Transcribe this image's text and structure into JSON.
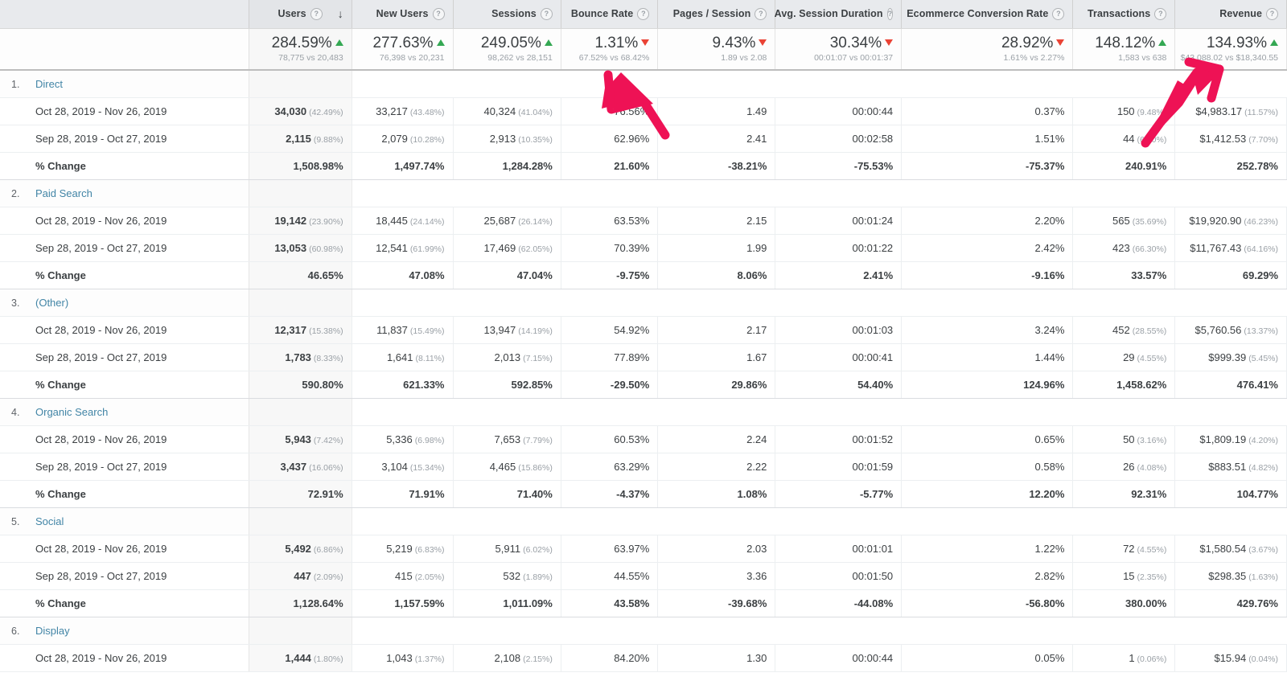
{
  "table": {
    "dimension_header": "",
    "columns": [
      {
        "key": "users",
        "label": "Users",
        "help": "?",
        "sorted": true,
        "sort_dir": "desc"
      },
      {
        "key": "new_users",
        "label": "New Users",
        "help": "?",
        "sorted": false
      },
      {
        "key": "sessions",
        "label": "Sessions",
        "help": "?",
        "sorted": false
      },
      {
        "key": "bounce_rate",
        "label": "Bounce Rate",
        "help": "?",
        "sorted": false
      },
      {
        "key": "pages_session",
        "label": "Pages / Session",
        "help": "?",
        "sorted": false
      },
      {
        "key": "avg_duration",
        "label": "Avg. Session Duration",
        "help": "?",
        "sorted": false
      },
      {
        "key": "ecommerce_cr",
        "label": "Ecommerce Conversion Rate",
        "help": "?",
        "sorted": false
      },
      {
        "key": "transactions",
        "label": "Transactions",
        "help": "?",
        "sorted": false
      },
      {
        "key": "revenue",
        "label": "Revenue",
        "help": "?",
        "sorted": false
      }
    ],
    "sort_icon": "↓",
    "summary": [
      {
        "value": "284.59%",
        "direction": "up",
        "compare": "78,775 vs 20,483"
      },
      {
        "value": "277.63%",
        "direction": "up",
        "compare": "76,398 vs 20,231"
      },
      {
        "value": "249.05%",
        "direction": "up",
        "compare": "98,262 vs 28,151"
      },
      {
        "value": "1.31%",
        "direction": "down",
        "compare": "67.52% vs 68.42%"
      },
      {
        "value": "9.43%",
        "direction": "down",
        "compare": "1.89 vs 2.08"
      },
      {
        "value": "30.34%",
        "direction": "down",
        "compare": "00:01:07 vs 00:01:37"
      },
      {
        "value": "28.92%",
        "direction": "down",
        "compare": "1.61% vs 2.27%"
      },
      {
        "value": "148.12%",
        "direction": "up",
        "compare": "1,583 vs 638"
      },
      {
        "value": "134.93%",
        "direction": "up",
        "compare": "$43,088.02 vs $18,340.55"
      }
    ],
    "row_labels": {
      "period_current": "Oct 28, 2019 - Nov 26, 2019",
      "period_previous": "Sep 28, 2019 - Oct 27, 2019",
      "change": "% Change"
    },
    "groups": [
      {
        "index": "1.",
        "name": "Direct",
        "current": [
          "34,030",
          "33,217",
          "40,324",
          "76.56%",
          "1.49",
          "00:00:44",
          "0.37%",
          "150",
          "$4,983.17"
        ],
        "current_pct": [
          "(42.49%)",
          "(43.48%)",
          "(41.04%)",
          "",
          "",
          "",
          "",
          "(9.48%)",
          "(11.57%)"
        ],
        "previous": [
          "2,115",
          "2,079",
          "2,913",
          "62.96%",
          "2.41",
          "00:02:58",
          "1.51%",
          "44",
          "$1,412.53"
        ],
        "previous_pct": [
          "(9.88%)",
          "(10.28%)",
          "(10.35%)",
          "",
          "",
          "",
          "",
          "(6.90%)",
          "(7.70%)"
        ],
        "change": [
          "1,508.98%",
          "1,497.74%",
          "1,284.28%",
          "21.60%",
          "-38.21%",
          "-75.53%",
          "-75.37%",
          "240.91%",
          "252.78%"
        ]
      },
      {
        "index": "2.",
        "name": "Paid Search",
        "current": [
          "19,142",
          "18,445",
          "25,687",
          "63.53%",
          "2.15",
          "00:01:24",
          "2.20%",
          "565",
          "$19,920.90"
        ],
        "current_pct": [
          "(23.90%)",
          "(24.14%)",
          "(26.14%)",
          "",
          "",
          "",
          "",
          "(35.69%)",
          "(46.23%)"
        ],
        "previous": [
          "13,053",
          "12,541",
          "17,469",
          "70.39%",
          "1.99",
          "00:01:22",
          "2.42%",
          "423",
          "$11,767.43"
        ],
        "previous_pct": [
          "(60.98%)",
          "(61.99%)",
          "(62.05%)",
          "",
          "",
          "",
          "",
          "(66.30%)",
          "(64.16%)"
        ],
        "change": [
          "46.65%",
          "47.08%",
          "47.04%",
          "-9.75%",
          "8.06%",
          "2.41%",
          "-9.16%",
          "33.57%",
          "69.29%"
        ]
      },
      {
        "index": "3.",
        "name": "(Other)",
        "current": [
          "12,317",
          "11,837",
          "13,947",
          "54.92%",
          "2.17",
          "00:01:03",
          "3.24%",
          "452",
          "$5,760.56"
        ],
        "current_pct": [
          "(15.38%)",
          "(15.49%)",
          "(14.19%)",
          "",
          "",
          "",
          "",
          "(28.55%)",
          "(13.37%)"
        ],
        "previous": [
          "1,783",
          "1,641",
          "2,013",
          "77.89%",
          "1.67",
          "00:00:41",
          "1.44%",
          "29",
          "$999.39"
        ],
        "previous_pct": [
          "(8.33%)",
          "(8.11%)",
          "(7.15%)",
          "",
          "",
          "",
          "",
          "(4.55%)",
          "(5.45%)"
        ],
        "change": [
          "590.80%",
          "621.33%",
          "592.85%",
          "-29.50%",
          "29.86%",
          "54.40%",
          "124.96%",
          "1,458.62%",
          "476.41%"
        ]
      },
      {
        "index": "4.",
        "name": "Organic Search",
        "current": [
          "5,943",
          "5,336",
          "7,653",
          "60.53%",
          "2.24",
          "00:01:52",
          "0.65%",
          "50",
          "$1,809.19"
        ],
        "current_pct": [
          "(7.42%)",
          "(6.98%)",
          "(7.79%)",
          "",
          "",
          "",
          "",
          "(3.16%)",
          "(4.20%)"
        ],
        "previous": [
          "3,437",
          "3,104",
          "4,465",
          "63.29%",
          "2.22",
          "00:01:59",
          "0.58%",
          "26",
          "$883.51"
        ],
        "previous_pct": [
          "(16.06%)",
          "(15.34%)",
          "(15.86%)",
          "",
          "",
          "",
          "",
          "(4.08%)",
          "(4.82%)"
        ],
        "change": [
          "72.91%",
          "71.91%",
          "71.40%",
          "-4.37%",
          "1.08%",
          "-5.77%",
          "12.20%",
          "92.31%",
          "104.77%"
        ]
      },
      {
        "index": "5.",
        "name": "Social",
        "current": [
          "5,492",
          "5,219",
          "5,911",
          "63.97%",
          "2.03",
          "00:01:01",
          "1.22%",
          "72",
          "$1,580.54"
        ],
        "current_pct": [
          "(6.86%)",
          "(6.83%)",
          "(6.02%)",
          "",
          "",
          "",
          "",
          "(4.55%)",
          "(3.67%)"
        ],
        "previous": [
          "447",
          "415",
          "532",
          "44.55%",
          "3.36",
          "00:01:50",
          "2.82%",
          "15",
          "$298.35"
        ],
        "previous_pct": [
          "(2.09%)",
          "(2.05%)",
          "(1.89%)",
          "",
          "",
          "",
          "",
          "(2.35%)",
          "(1.63%)"
        ],
        "change": [
          "1,128.64%",
          "1,157.59%",
          "1,011.09%",
          "43.58%",
          "-39.68%",
          "-44.08%",
          "-56.80%",
          "380.00%",
          "429.76%"
        ]
      },
      {
        "index": "6.",
        "name": "Display",
        "current": [
          "1,444",
          "1,043",
          "2,108",
          "84.20%",
          "1.30",
          "00:00:44",
          "0.05%",
          "1",
          "$15.94"
        ],
        "current_pct": [
          "(1.80%)",
          "(1.37%)",
          "(2.15%)",
          "",
          "",
          "",
          "",
          "(0.06%)",
          "(0.04%)"
        ],
        "previous": null,
        "previous_pct": null,
        "change": null
      }
    ]
  },
  "annotations": {
    "arrow_color": "#EE1255",
    "arrows": [
      {
        "name": "arrow-pages-session",
        "target": "Pages / Session summary"
      },
      {
        "name": "arrow-revenue",
        "target": "Revenue summary"
      }
    ]
  },
  "colors": {
    "positive": "#34a853",
    "negative": "#ea4335",
    "link": "#4285a6",
    "header_bg": "#e8eaed",
    "sorted_bg": "#f8f8f8"
  }
}
